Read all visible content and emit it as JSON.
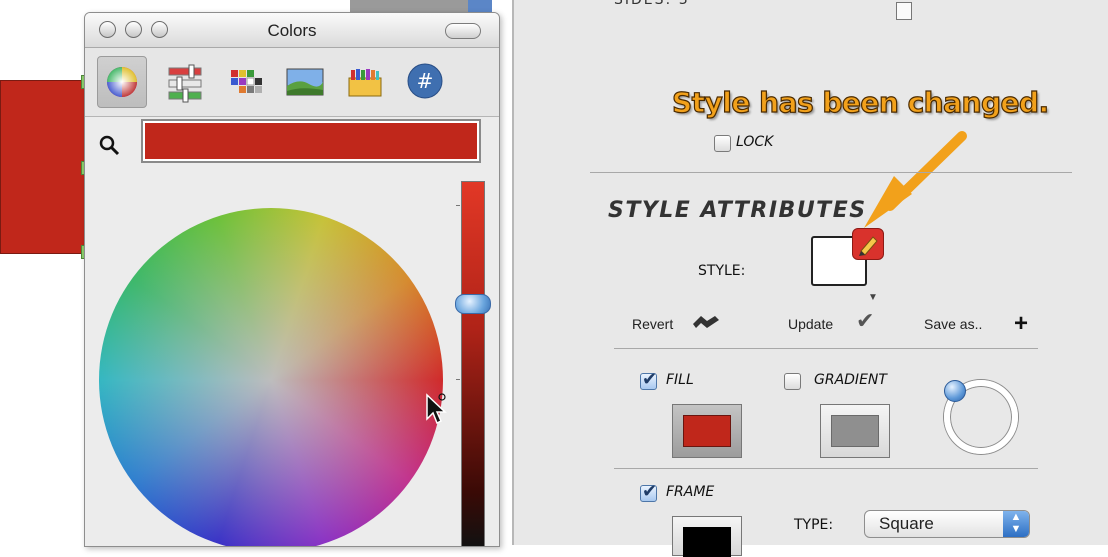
{
  "colors_window": {
    "title": "Colors",
    "toolbar_tools": [
      {
        "name": "color-wheel-icon"
      },
      {
        "name": "color-sliders-icon"
      },
      {
        "name": "color-palettes-icon"
      },
      {
        "name": "image-palettes-icon"
      },
      {
        "name": "crayons-icon"
      },
      {
        "name": "hex-picker-icon",
        "glyph": "#"
      }
    ],
    "selected_tool": "color-wheel-icon",
    "current_color": "#c0271b"
  },
  "inspector": {
    "annotation": "Style has been changed.",
    "lock_label": "LOCK",
    "section_heading": "STYLE ATTRIBUTES",
    "style_label": "STYLE:",
    "actions": {
      "revert": "Revert",
      "update": "Update",
      "save_as": "Save as.."
    },
    "fill_label": "FILL",
    "gradient_label": "GRADIENT",
    "frame_label": "FRAME",
    "type_label": "TYPE:",
    "type_value": "Square",
    "checkboxes": {
      "lock": false,
      "fill": true,
      "gradient": false,
      "frame": true
    },
    "fill_color": "#c0271b",
    "gradient_color": "#8f8f8f",
    "frame_color": "#000000"
  }
}
